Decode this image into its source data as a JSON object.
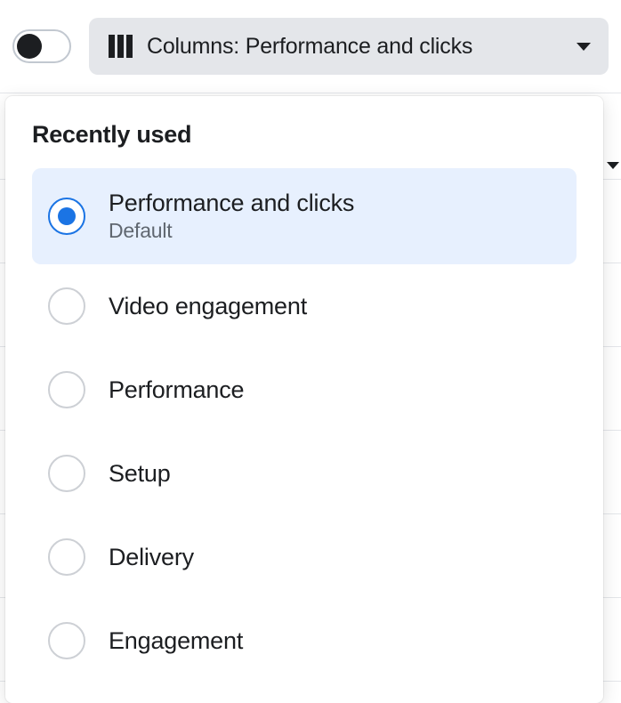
{
  "toolbar": {
    "toggle_on": false,
    "columns_prefix": "Columns:",
    "columns_value": "Performance and clicks"
  },
  "panel": {
    "section_title": "Recently used",
    "options": [
      {
        "label": "Performance and clicks",
        "sublabel": "Default",
        "selected": true
      },
      {
        "label": "Video engagement",
        "sublabel": "",
        "selected": false
      },
      {
        "label": "Performance",
        "sublabel": "",
        "selected": false
      },
      {
        "label": "Setup",
        "sublabel": "",
        "selected": false
      },
      {
        "label": "Delivery",
        "sublabel": "",
        "selected": false
      },
      {
        "label": "Engagement",
        "sublabel": "",
        "selected": false
      }
    ]
  }
}
